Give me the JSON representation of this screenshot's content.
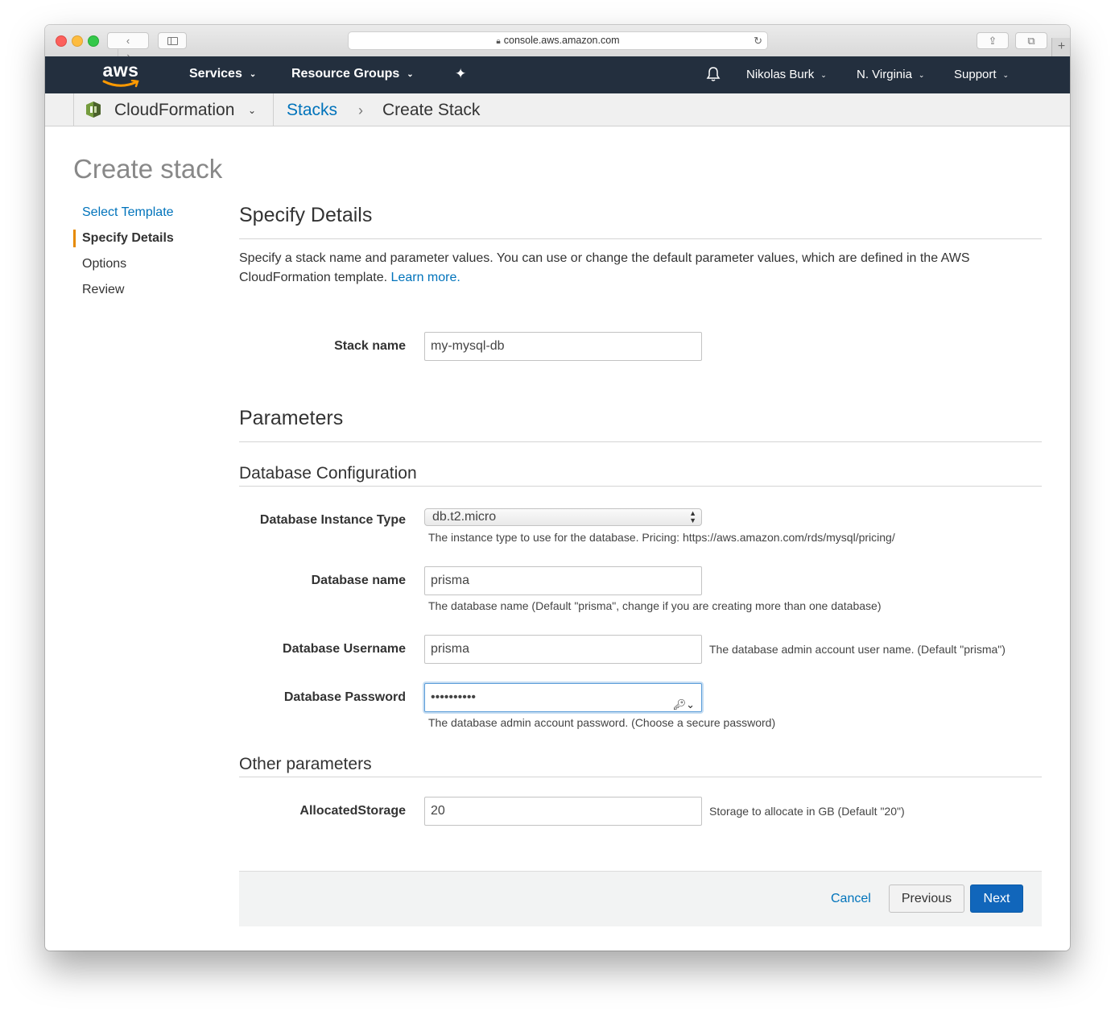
{
  "browser": {
    "url": "console.aws.amazon.com",
    "back_glyph": "‹",
    "forward_glyph": "›",
    "reload_glyph": "↻",
    "share_glyph": "⇪",
    "tabs_glyph": "⧉",
    "newtab_glyph": "+"
  },
  "awsnav": {
    "logo": "aws",
    "services": "Services",
    "resource_groups": "Resource Groups",
    "user": "Nikolas Burk",
    "region": "N. Virginia",
    "support": "Support",
    "caret": "⌄",
    "pin_glyph": "✦"
  },
  "breadcrumb": {
    "service": "CloudFormation",
    "caret": "⌄",
    "link": "Stacks",
    "separator": "›",
    "current": "Create Stack"
  },
  "page": {
    "title": "Create stack"
  },
  "wizard": {
    "steps": [
      {
        "label": "Select Template"
      },
      {
        "label": "Specify Details"
      },
      {
        "label": "Options"
      },
      {
        "label": "Review"
      }
    ]
  },
  "details": {
    "heading": "Specify Details",
    "intro": "Specify a stack name and parameter values. You can use or change the default parameter values, which are defined in the AWS CloudFormation template.",
    "learn_more": "Learn more."
  },
  "stack": {
    "label": "Stack name",
    "value": "my-mysql-db"
  },
  "parameters": {
    "heading": "Parameters",
    "db_config_heading": "Database Configuration",
    "instance_type": {
      "label": "Database Instance Type",
      "value": "db.t2.micro",
      "hint": "The instance type to use for the database. Pricing: https://aws.amazon.com/rds/mysql/pricing/"
    },
    "db_name": {
      "label": "Database name",
      "value": "prisma",
      "hint": "The database name (Default \"prisma\", change if you are creating more than one database)"
    },
    "db_username": {
      "label": "Database Username",
      "value": "prisma",
      "hint": "The database admin account user name. (Default \"prisma\")"
    },
    "db_password": {
      "label": "Database Password",
      "value": "••••••••••",
      "key_glyph": "🔑︎⌄",
      "hint": "The database admin account password. (Choose a secure password)"
    },
    "other_heading": "Other parameters",
    "allocated_storage": {
      "label": "AllocatedStorage",
      "value": "20",
      "hint": "Storage to allocate in GB (Default \"20\")"
    }
  },
  "footer": {
    "cancel": "Cancel",
    "previous": "Previous",
    "next": "Next"
  },
  "colors": {
    "aws_nav": "#232f3e",
    "link": "#0073bb",
    "primary_button": "#1166bb",
    "active_step_bar": "#e68a00",
    "aws_smile": "#ff9900"
  }
}
